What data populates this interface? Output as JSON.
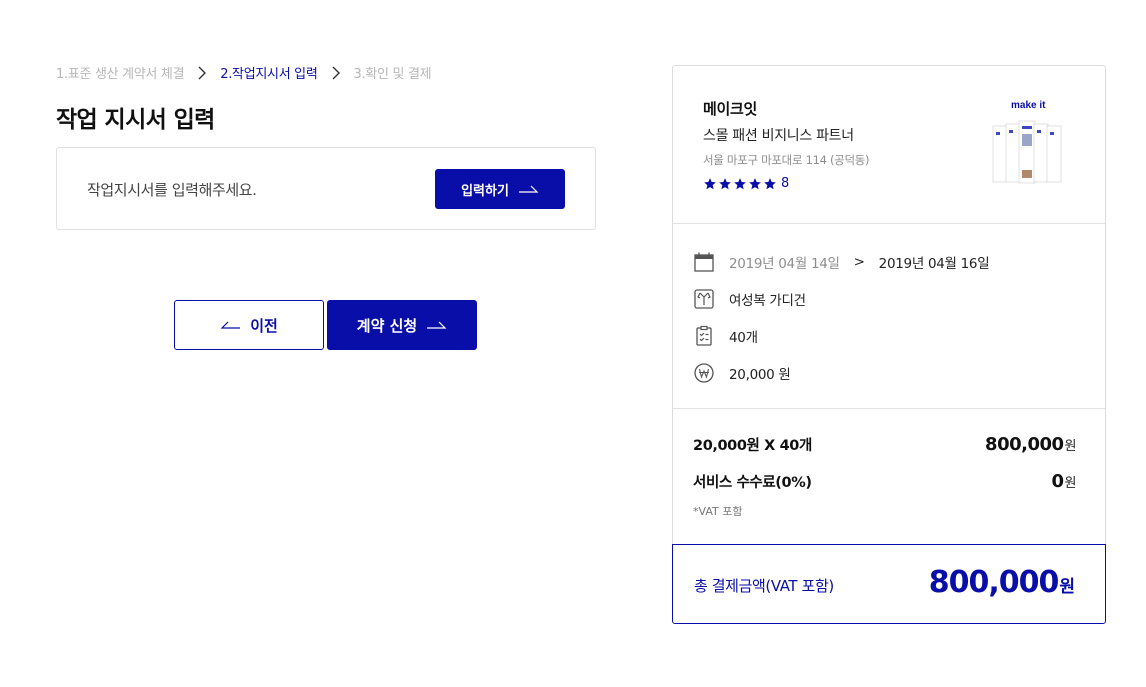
{
  "steps": [
    {
      "label": "1.표준 생산 계약서 체결",
      "state": "done"
    },
    {
      "label": "2.작업지시서 입력",
      "state": "active"
    },
    {
      "label": "3.확인 및 결제",
      "state": "todo"
    }
  ],
  "page_title": "작업 지시서 입력",
  "input_card": {
    "prompt": "작업지시서를 입력해주세요.",
    "button_label": "입력하기"
  },
  "actions": {
    "prev_label": "이전",
    "apply_label": "계약 신청"
  },
  "seller": {
    "name": "메이크잇",
    "description": "스몰 패션 비지니스 파트너",
    "address": "서울 마포구 마포대로 114 (공덕동)",
    "rating_stars": 5,
    "rating_count": "8",
    "thumb_title": "make it"
  },
  "order": {
    "date_start": "2019년 04월 14일",
    "date_arrow": ">",
    "date_end": "2019년 04월 16일",
    "product": "여성복 가디건",
    "quantity": "40개",
    "unit_price": "20,000 원"
  },
  "costs": {
    "subtotal_label": "20,000원 X 40개",
    "subtotal_value": "800,000",
    "fee_label": "서비스 수수료(0%)",
    "fee_value": "0",
    "currency_unit": "원",
    "vat_note": "*VAT 포함"
  },
  "total": {
    "label": "총 결제금액(VAT 포함)",
    "value": "800,000",
    "unit": "원"
  },
  "colors": {
    "accent": "#0a0ea8",
    "muted": "#b7b7b7",
    "border": "#e1e1e1"
  }
}
